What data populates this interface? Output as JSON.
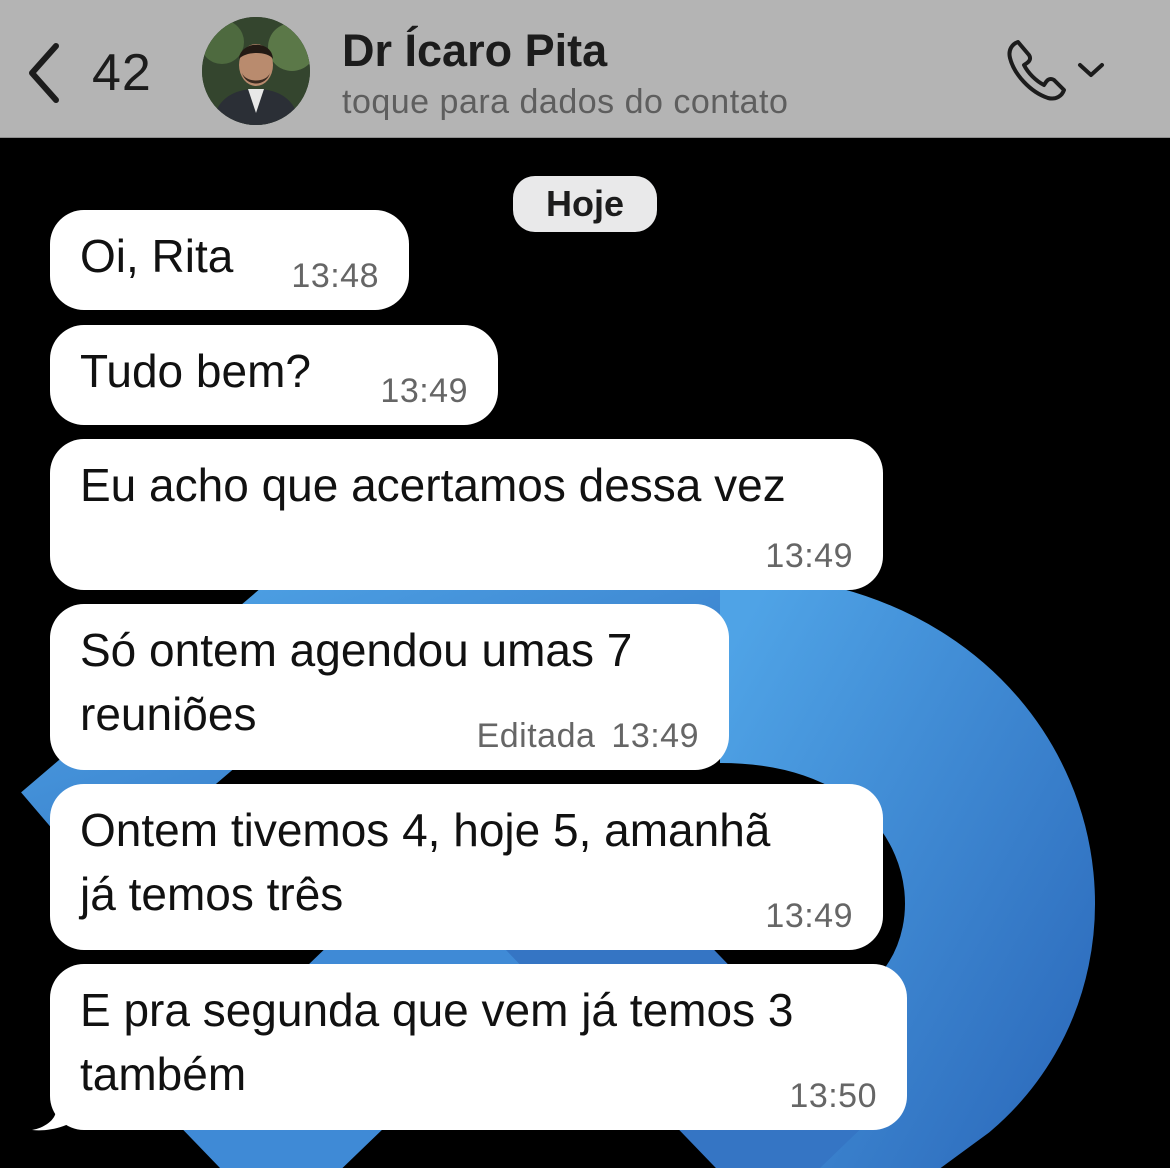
{
  "header": {
    "back_count": "42",
    "contact_name": "Dr Ícaro Pita",
    "contact_subtitle": "toque para dados do contato",
    "icons": [
      "chevron-left-icon",
      "avatar",
      "phone-icon",
      "chevron-down-icon"
    ]
  },
  "chat": {
    "date_label": "Hoje",
    "messages": [
      {
        "text": "Oi, Rita",
        "time": "13:48"
      },
      {
        "text": "Tudo bem?",
        "time": "13:49"
      },
      {
        "text": "Eu acho que acertamos dessa vez",
        "time": "13:49"
      },
      {
        "text": "Só ontem agendou umas 7\nreuniões",
        "edited": "Editada",
        "time": "13:49"
      },
      {
        "text": "Ontem tivemos 4, hoje 5, amanhã\njá temos três",
        "time": "13:49"
      },
      {
        "text": "E pra segunda que vem já temos 3\ntambém",
        "time": "13:50"
      }
    ]
  },
  "colors": {
    "header_bg": "#b4b4b4",
    "chat_bg": "#000000",
    "bubble_bg": "#ffffff",
    "art_blue": "#3d8fd8"
  }
}
